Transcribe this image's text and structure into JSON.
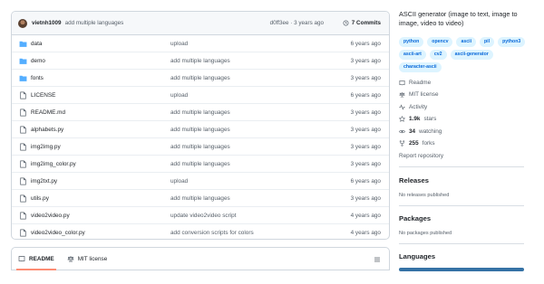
{
  "commit": {
    "author": "vietnh1009",
    "message": "add multiple languages",
    "meta": "d0ff3ee · 3 years ago",
    "commits_label": "7 Commits"
  },
  "files": [
    {
      "type": "folder",
      "name": "data",
      "message": "upload",
      "age": "6 years ago"
    },
    {
      "type": "folder",
      "name": "demo",
      "message": "add multiple languages",
      "age": "3 years ago"
    },
    {
      "type": "folder",
      "name": "fonts",
      "message": "add multiple languages",
      "age": "3 years ago"
    },
    {
      "type": "file",
      "name": "LICENSE",
      "message": "upload",
      "age": "6 years ago"
    },
    {
      "type": "file",
      "name": "README.md",
      "message": "add multiple languages",
      "age": "3 years ago"
    },
    {
      "type": "file",
      "name": "alphabets.py",
      "message": "add multiple languages",
      "age": "3 years ago"
    },
    {
      "type": "file",
      "name": "img2img.py",
      "message": "add multiple languages",
      "age": "3 years ago"
    },
    {
      "type": "file",
      "name": "img2img_color.py",
      "message": "add multiple languages",
      "age": "3 years ago"
    },
    {
      "type": "file",
      "name": "img2txt.py",
      "message": "upload",
      "age": "6 years ago"
    },
    {
      "type": "file",
      "name": "utils.py",
      "message": "add multiple languages",
      "age": "3 years ago"
    },
    {
      "type": "file",
      "name": "video2video.py",
      "message": "update video2video script",
      "age": "4 years ago"
    },
    {
      "type": "file",
      "name": "video2video_color.py",
      "message": "add conversion scripts for colors",
      "age": "4 years ago"
    }
  ],
  "readme_tabs": {
    "readme": "README",
    "license": "MIT license"
  },
  "sidebar": {
    "about": "ASCII generator (image to text, image to image, video to video)",
    "topics": [
      "python",
      "opencv",
      "ascii",
      "pil",
      "python3",
      "ascii-art",
      "cv2",
      "ascii-generator",
      "character-ascii"
    ],
    "readme_link": "Readme",
    "license_link": "MIT license",
    "activity_link": "Activity",
    "stars_count": "1.9k",
    "stars_label": "stars",
    "watching_count": "34",
    "watching_label": "watching",
    "forks_count": "255",
    "forks_label": "forks",
    "report_link": "Report repository",
    "releases_title": "Releases",
    "releases_note": "No releases published",
    "packages_title": "Packages",
    "packages_note": "No packages published",
    "languages_title": "Languages"
  },
  "colors": {
    "folder": "#54aeff",
    "link": "#0969da",
    "topic_bg": "#ddf4ff",
    "python_lang": "#3572a5",
    "tab_underline": "#fd8c73"
  }
}
